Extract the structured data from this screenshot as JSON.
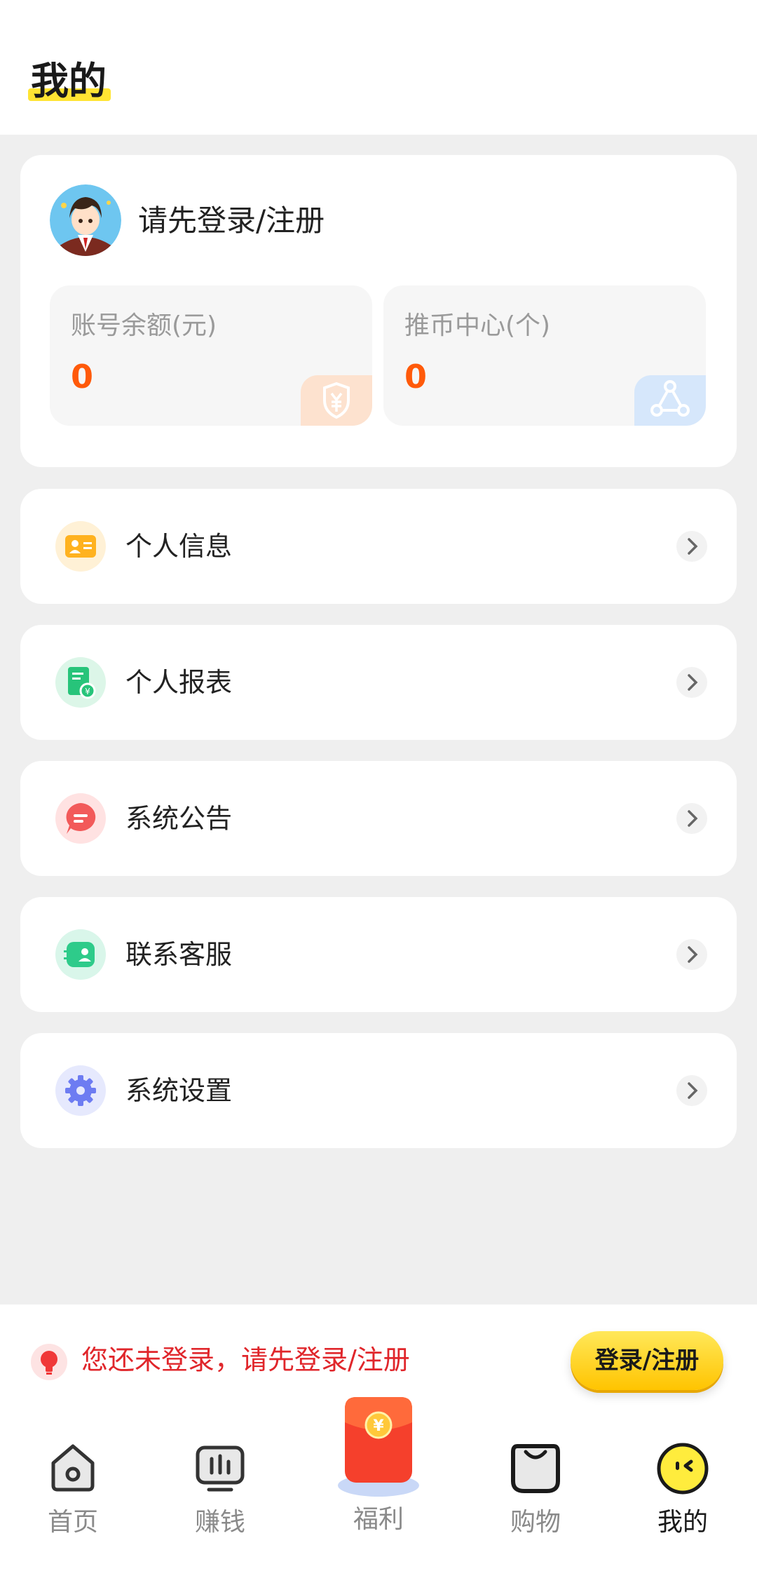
{
  "header": {
    "title": "我的"
  },
  "profile": {
    "login_prompt": "请先登录/注册",
    "balance": {
      "label": "账号余额(元)",
      "value": "0"
    },
    "coins": {
      "label": "推币中心(个)",
      "value": "0"
    }
  },
  "menu": [
    {
      "label": "个人信息",
      "icon": "id-card-icon",
      "color": "#ffb21f"
    },
    {
      "label": "个人报表",
      "icon": "report-icon",
      "color": "#27c47a"
    },
    {
      "label": "系统公告",
      "icon": "announcement-icon",
      "color": "#f25a5a"
    },
    {
      "label": "联系客服",
      "icon": "customer-service-icon",
      "color": "#2ecb8a"
    },
    {
      "label": "系统设置",
      "icon": "settings-gear-icon",
      "color": "#6d7cf2"
    }
  ],
  "notice": {
    "text": "您还未登录，请先登录/注册",
    "button": "登录/注册"
  },
  "tabs": [
    {
      "label": "首页",
      "icon": "home-icon",
      "active": false
    },
    {
      "label": "赚钱",
      "icon": "chart-monitor-icon",
      "active": false
    },
    {
      "label": "福利",
      "icon": "red-envelope-icon",
      "active": false
    },
    {
      "label": "购物",
      "icon": "shopping-bag-icon",
      "active": false
    },
    {
      "label": "我的",
      "icon": "profile-face-icon",
      "active": true
    }
  ]
}
